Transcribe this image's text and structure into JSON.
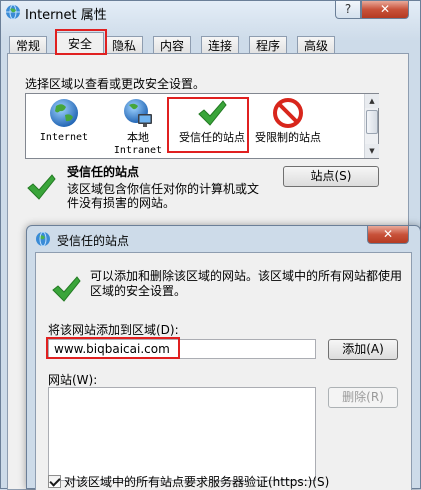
{
  "outer_window": {
    "title": "Internet 属性",
    "help_glyph": "?",
    "close_glyph": "✕"
  },
  "tabs": [
    {
      "label": "常规",
      "active": false
    },
    {
      "label": "安全",
      "active": true
    },
    {
      "label": "隐私",
      "active": false
    },
    {
      "label": "内容",
      "active": false
    },
    {
      "label": "连接",
      "active": false
    },
    {
      "label": "程序",
      "active": false
    },
    {
      "label": "高级",
      "active": false
    }
  ],
  "security": {
    "prompt": "选择区域以查看或更改安全设置。",
    "zones": [
      {
        "label": "Internet",
        "icon": "globe-icon"
      },
      {
        "label_line1": "本地",
        "label_line2": "Intranet",
        "icon": "intranet-globe-icon"
      },
      {
        "label": "受信任的站点",
        "icon": "green-check-icon"
      },
      {
        "label": "受限制的站点",
        "icon": "restricted-icon"
      }
    ],
    "selected_zone_name": "受信任的站点",
    "selected_zone_desc": "该区域包含你信任对你的计算机或文件没有损害的网站。",
    "sites_button": "站点(S)"
  },
  "dialog": {
    "title": "受信任的站点",
    "close_glyph": "✕",
    "info": "可以添加和删除该区域的网站。该区域中的所有网站都使用区域的安全设置。",
    "add_label": "将该网站添加到区域(D):",
    "add_value": "www.biqbaicai.com",
    "add_button": "添加(A)",
    "sites_label": "网站(W):",
    "remove_button": "删除(R)",
    "verify_label": "对该区域中的所有站点要求服务器验证(https:)(S)",
    "verify_checked": true
  },
  "colors": {
    "highlight_box": "#e02020",
    "check_green": "#3aa53a",
    "restricted_red": "#d8261c"
  }
}
